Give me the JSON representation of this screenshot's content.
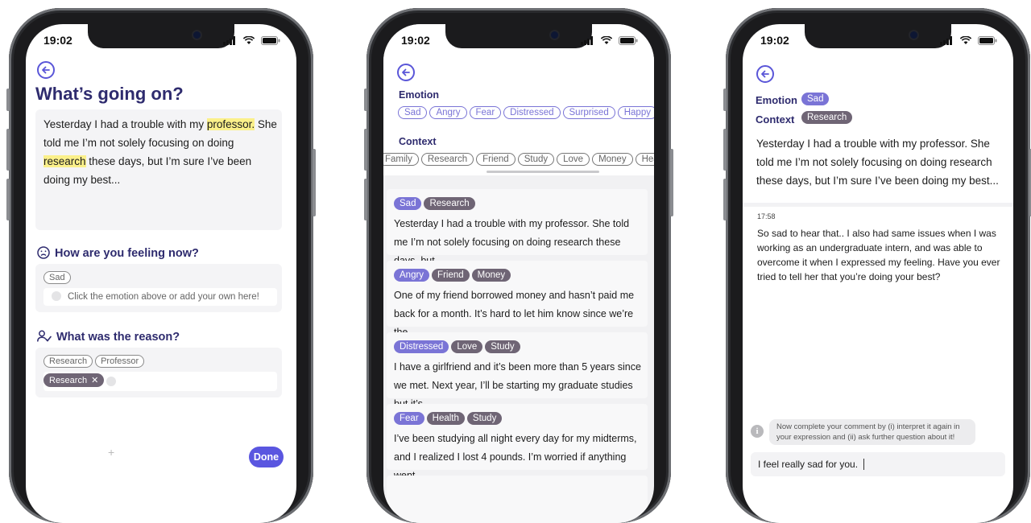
{
  "colors": {
    "accent": "#5a56e0",
    "heading": "#2e2b6e",
    "emotion_tag": "#7a74d6",
    "context_tag": "#6f6575",
    "highlight": "#fbf08a"
  },
  "status": {
    "time": "19:02"
  },
  "screen1": {
    "title": "What’s going on?",
    "entry": {
      "p1": "Yesterday I had a trouble with my ",
      "hl1": "professor.",
      "p2": " She told me I’m not solely focusing on doing ",
      "hl2": "research",
      "p3": " these days, but I’m sure I’ve been doing my best..."
    },
    "feeling": {
      "question": "How are you feeling now?",
      "suggestion": "Sad",
      "placeholder": "Click the emotion above or add your own here!"
    },
    "reason": {
      "question": "What was the reason?",
      "suggestions": [
        "Research",
        "Professor"
      ],
      "selected": "Research"
    },
    "plus": "+",
    "done_label": "Done"
  },
  "screen2": {
    "emotion_label": "Emotion",
    "emotions": [
      "Sad",
      "Angry",
      "Fear",
      "Distressed",
      "Surprised",
      "Happy"
    ],
    "context_label": "Context",
    "contexts": [
      "Family",
      "Research",
      "Friend",
      "Study",
      "Love",
      "Money",
      "Health"
    ],
    "entries": [
      {
        "emotion": "Sad",
        "contexts": [
          "Research"
        ],
        "text": "Yesterday I had a trouble with my professor. She told me I’m not solely focusing on doing research these days, but..."
      },
      {
        "emotion": "Angry",
        "contexts": [
          "Friend",
          "Money"
        ],
        "text": "One of my friend borrowed money and hasn’t paid me back for a month. It’s hard to let him know since we’re the..."
      },
      {
        "emotion": "Distressed",
        "contexts": [
          "Love",
          "Study"
        ],
        "text": "I have a girlfriend and it’s been more than 5 years since we met. Next year, I’ll be starting my graduate studies but it’s..."
      },
      {
        "emotion": "Fear",
        "contexts": [
          "Health",
          "Study"
        ],
        "text": "I’ve been studying all night every day for my midterms, and I realized I lost 4 pounds. I’m worried if anything went..."
      }
    ]
  },
  "screen3": {
    "emotion_label": "Emotion",
    "emotion": "Sad",
    "context_label": "Context",
    "context": "Research",
    "entry": "Yesterday I had a trouble with my professor. She told me I’m not solely focusing on doing research these days, but I’m sure I’ve been doing my best...",
    "comment_time": "17:58",
    "comment": "So sad to hear that.. I also had same issues when I was working as an undergraduate intern, and was able to overcome it when I expressed my feeling. Have you ever tried to tell her that you’re doing your best?",
    "hint": "Now complete your comment by (i) interpret it again in your expression and (ii) ask further question about it!",
    "input_value": "I feel really sad for you."
  }
}
